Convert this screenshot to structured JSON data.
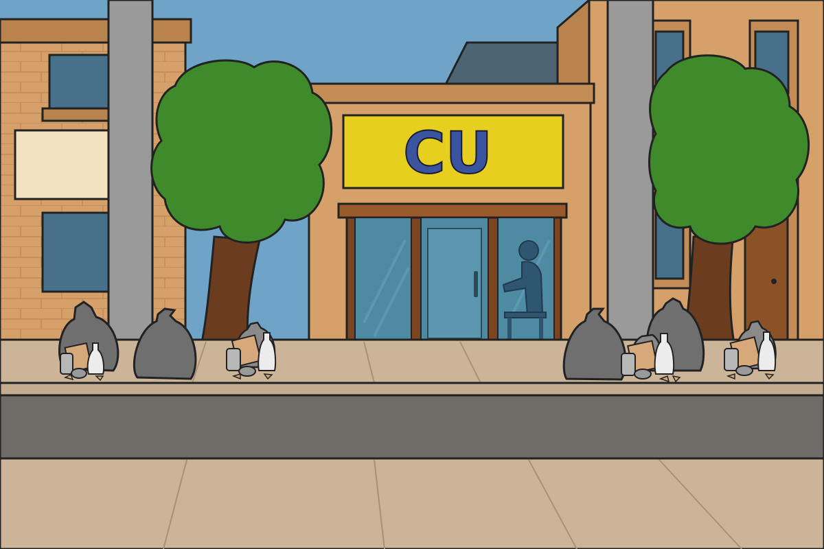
{
  "scene": {
    "store_sign": {
      "text": "CU"
    }
  },
  "colors": {
    "sky": "#6fa3c7",
    "building": "#d6a06a",
    "building_dark": "#b9834e",
    "sign_background": "#e6cf1e",
    "sign_text": "#3a54a0",
    "glass": "#4f8aa3",
    "foliage": "#3f8a2a",
    "trunk": "#6b3d1e",
    "pole": "#9a9a9a",
    "road": "#6f6b66",
    "sidewalk": "#ccb498",
    "trash_bag": "#6f6f6f"
  },
  "icons": [
    "trash-bag-icon",
    "can-icon",
    "bottle-icon",
    "paper-icon",
    "person-silhouette-icon",
    "door-handle-icon"
  ]
}
